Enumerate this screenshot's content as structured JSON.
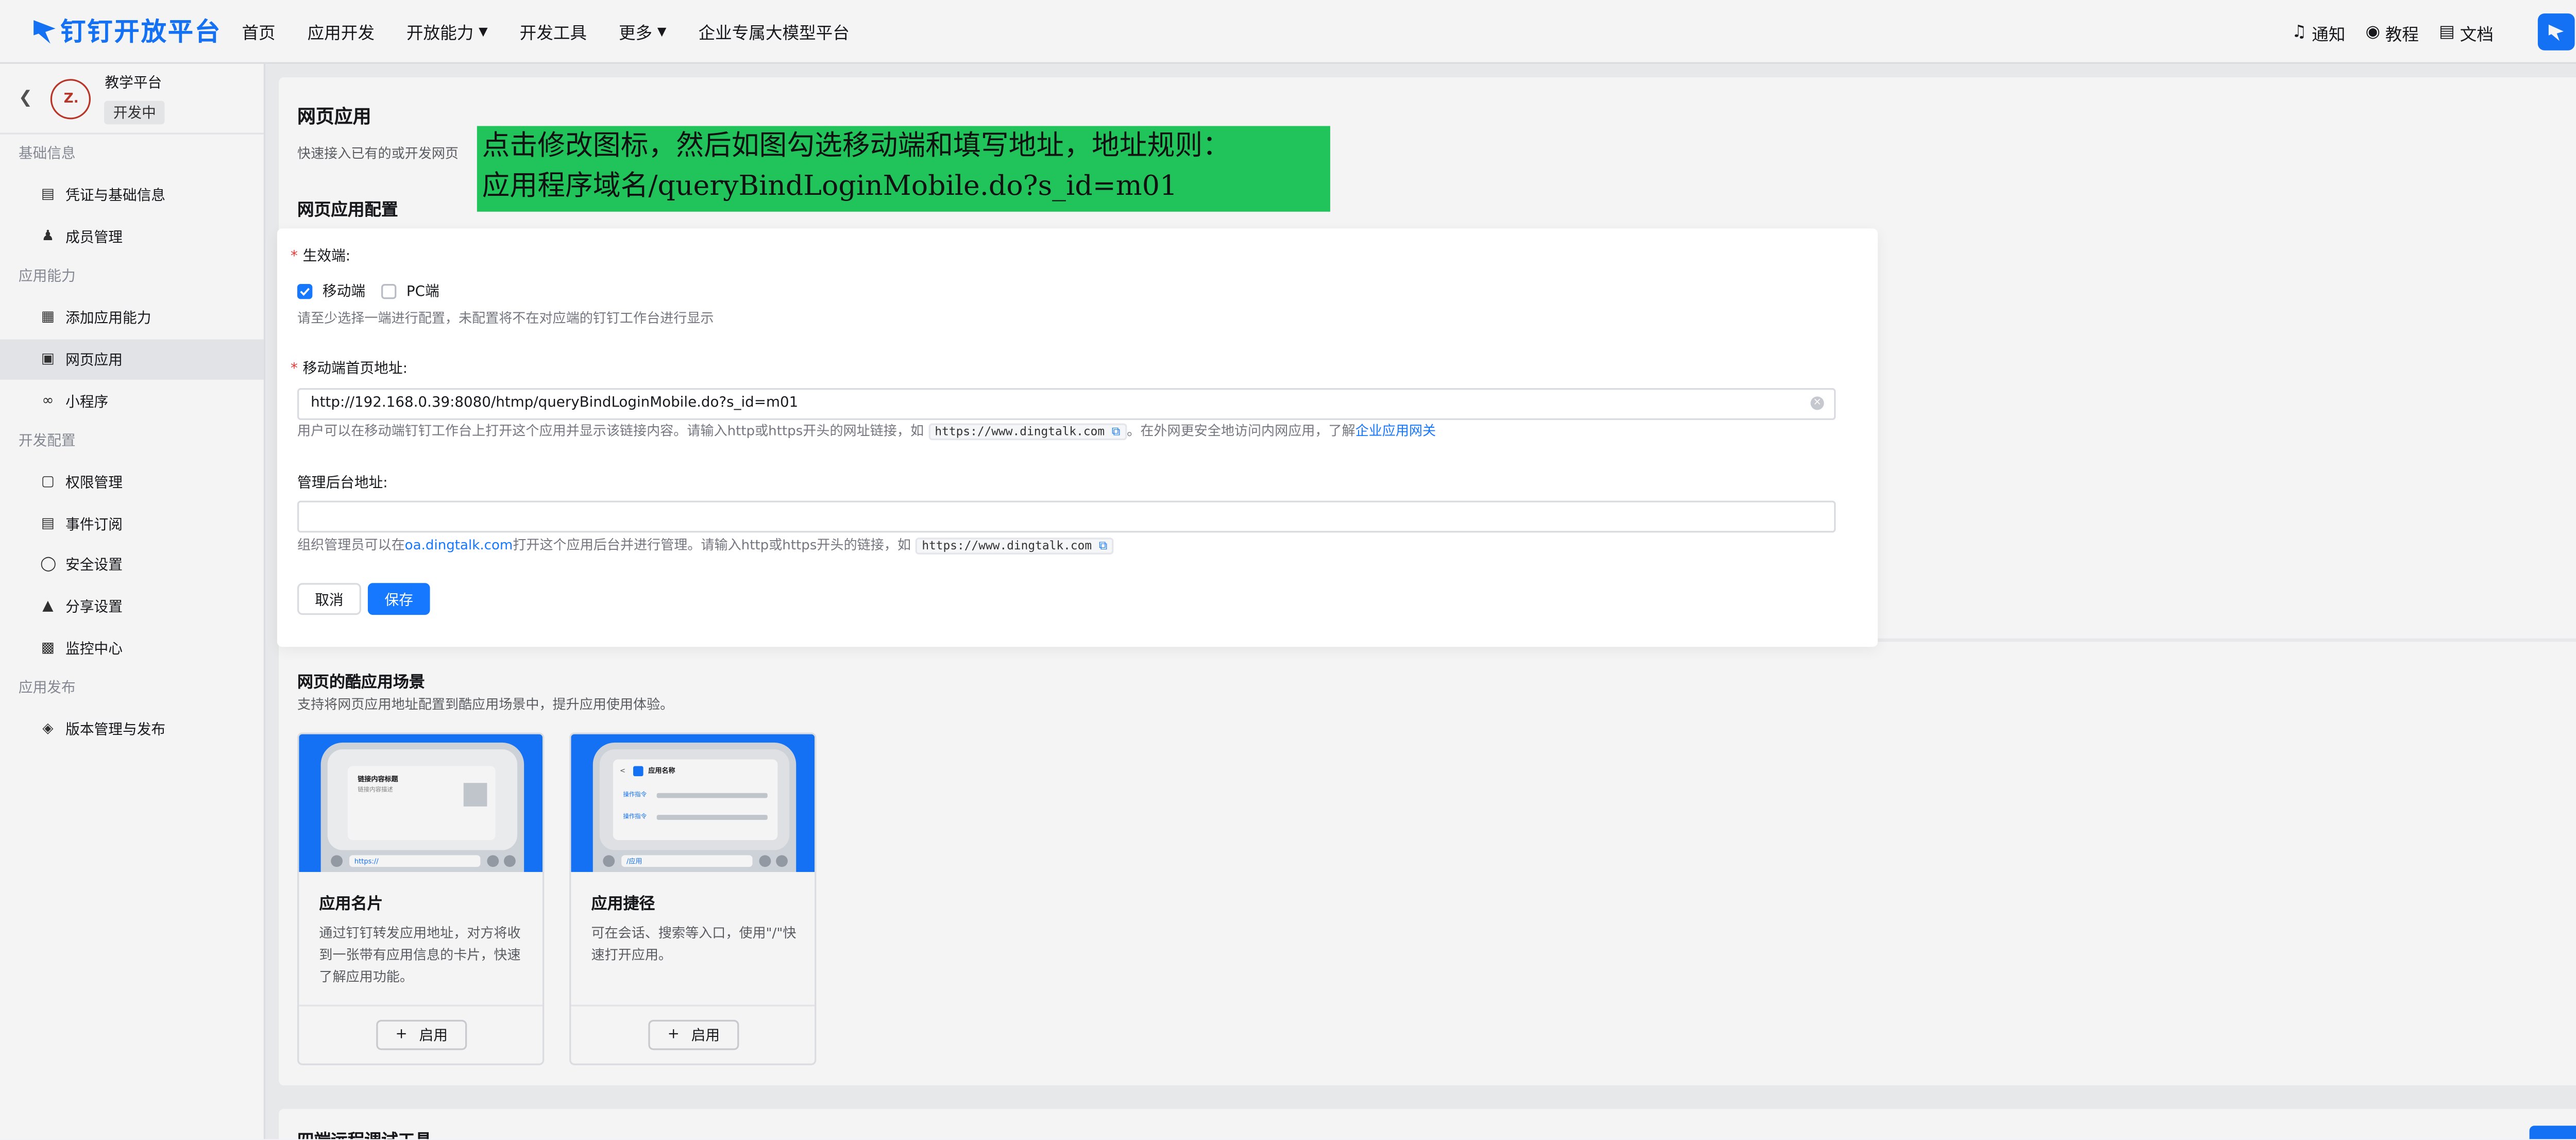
{
  "nav": {
    "logo_text": "钉钉开放平台",
    "items": [
      "首页",
      "应用开发",
      "开放能力",
      "开发工具",
      "更多",
      "企业专属大模型平台"
    ],
    "right": [
      {
        "icon": "bell-icon",
        "label": "通知"
      },
      {
        "icon": "location-pin-icon",
        "label": "教程"
      },
      {
        "icon": "book-icon",
        "label": "文档"
      }
    ]
  },
  "sidebar": {
    "app_name": "教学平台",
    "app_status": "开发中",
    "groups": [
      {
        "title": "基础信息",
        "items": [
          "凭证与基础信息",
          "成员管理"
        ]
      },
      {
        "title": "应用能力",
        "items": [
          "添加应用能力",
          "网页应用",
          "小程序"
        ]
      },
      {
        "title": "开发配置",
        "items": [
          "权限管理",
          "事件订阅",
          "安全设置",
          "分享设置",
          "监控中心"
        ]
      },
      {
        "title": "应用发布",
        "items": [
          "版本管理与发布"
        ]
      }
    ]
  },
  "page": {
    "title": "网页应用",
    "subtitle": "快速接入已有的或开发网页",
    "section_config": "网页应用配置",
    "section_scene": "网页的酷应用场景",
    "section_scene_desc": "支持将网页应用地址配置到酷应用场景中，提升应用使用体验。",
    "bottom_title": "四端远程调试工具"
  },
  "annotation": {
    "line1": "点击修改图标，然后如图勾选移动端和填写地址，地址规则：",
    "line2": "应用程序域名/queryBindLoginMobile.do?s_id=m01"
  },
  "form": {
    "platform_label": "生效端:",
    "mobile_label": "移动端",
    "mobile_checked": true,
    "pc_label": "PC端",
    "pc_checked": false,
    "platform_hint": "请至少选择一端进行配置，未配置将不在对应端的钉钉工作台进行显示",
    "mobile_url_label": "移动端首页地址:",
    "mobile_url_value": "http://192.168.0.39:8080/htmp/queryBindLoginMobile.do?s_id=m01",
    "mobile_url_hint_pre": "用户可以在移动端钉钉工作台上打开这个应用并显示该链接内容。请输入http或https开头的网址链接，如",
    "mobile_url_hint_code": "https://www.dingtalk.com",
    "mobile_url_hint_mid": "。在外网更安全地访问内网应用，了解",
    "mobile_url_hint_link": "企业应用网关",
    "admin_url_label": "管理后台地址:",
    "admin_url_value": "",
    "admin_hint_pre": "组织管理员可以在",
    "admin_hint_link": "oa.dingtalk.com",
    "admin_hint_mid": "打开这个应用后台并进行管理。请输入http或https开头的链接，如",
    "admin_hint_code": "https://www.dingtalk.com",
    "cancel_label": "取消",
    "save_label": "保存"
  },
  "scenes": [
    {
      "title": "应用名片",
      "desc": "通过钉钉转发应用地址，对方将收到一张带有应用信息的卡片，快速了解应用功能。",
      "button": "启用",
      "preview_title": "链接内容标题",
      "preview_sub": "链接内容描述",
      "preview_url": "https://"
    },
    {
      "title": "应用捷径",
      "desc": "可在会话、搜索等入口，使用\"/\"快速打开应用。",
      "button": "启用",
      "preview_title": "应用名称",
      "preview_row1": "操作指令",
      "preview_row2": "操作指令",
      "preview_input": "/应用"
    }
  ],
  "colors": {
    "brand": "#1677ff",
    "annotation_bg": "#21c45a",
    "required": "#e53935"
  }
}
